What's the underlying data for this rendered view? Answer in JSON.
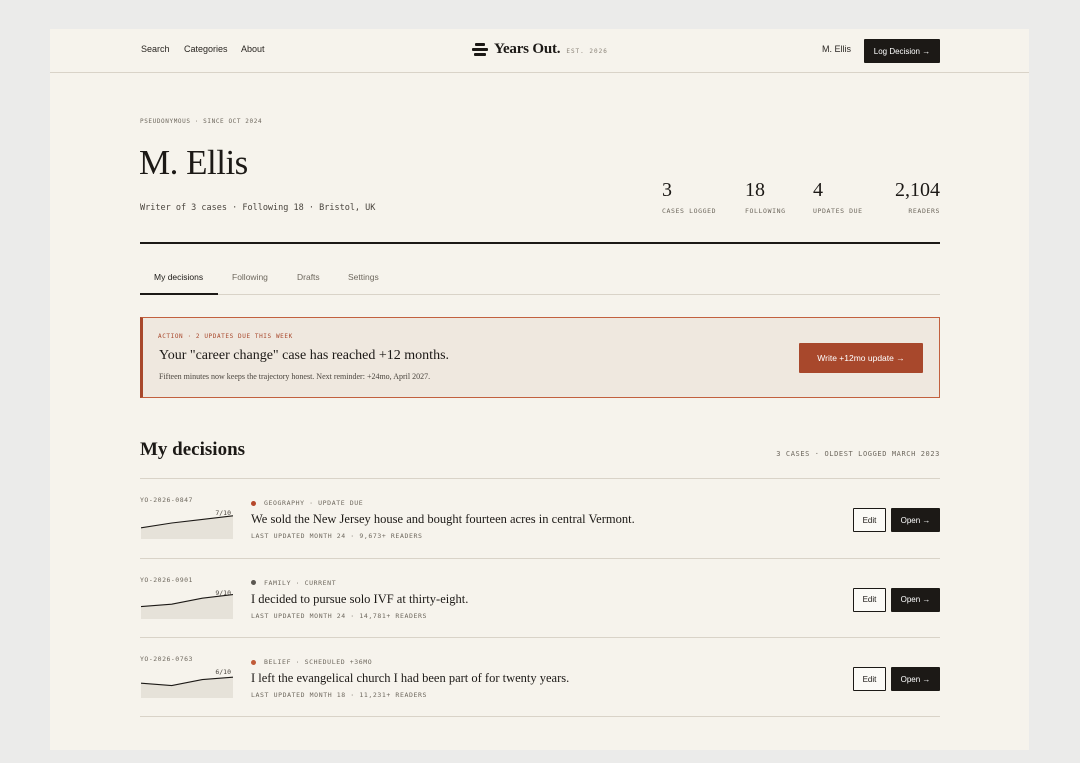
{
  "nav": {
    "links": [
      "Search",
      "Categories",
      "About"
    ],
    "logo_text": "Years Out.",
    "logo_est": "EST. 2026",
    "user_name": "M. Ellis",
    "log_button": "Log Decision →"
  },
  "profile": {
    "kicker": "PSEUDONYMOUS · SINCE OCT 2024",
    "name": "M. Ellis",
    "subline": "Writer of 3 cases · Following 18 · Bristol, UK",
    "stats": [
      {
        "value": "3",
        "label": "CASES LOGGED"
      },
      {
        "value": "18",
        "label": "FOLLOWING"
      },
      {
        "value": "4",
        "label": "UPDATES DUE"
      },
      {
        "value": "2,104",
        "label": "READERS"
      }
    ]
  },
  "tabs": [
    "My decisions",
    "Following",
    "Drafts",
    "Settings"
  ],
  "alert": {
    "kicker": "ACTION · 2 UPDATES DUE THIS WEEK",
    "title": "Your \"career change\" case has reached +12 months.",
    "sub": "Fifteen minutes now keeps the trajectory honest. Next reminder: +24mo, April 2027.",
    "button": "Write +12mo update →"
  },
  "section": {
    "title": "My decisions",
    "meta": "3 CASES · OLDEST LOGGED MARCH 2023"
  },
  "colors": {
    "accent": "#a8482c",
    "ink": "#1c1916",
    "paper": "#f6f3ec",
    "dot_due": "#b5472b",
    "dot_current": "#5b5751",
    "dot_scheduled": "#c05a38"
  },
  "decisions": [
    {
      "id": "YO-2026-0847",
      "spark_label": "7/10",
      "spark": [
        3,
        5,
        6.5,
        8
      ],
      "dot_color": "#b5472b",
      "tag": "GEOGRAPHY · UPDATE DUE",
      "title": "We sold the New Jersey house and bought fourteen acres in central Vermont.",
      "meta": "LAST UPDATED MONTH 24 · 9,673+ READERS",
      "edit": "Edit",
      "open": "Open →"
    },
    {
      "id": "YO-2026-0901",
      "spark_label": "9/10",
      "spark": [
        3.5,
        4.5,
        7,
        8.5
      ],
      "dot_color": "#5b5751",
      "tag": "FAMILY · CURRENT",
      "title": "I decided to pursue solo IVF at thirty-eight.",
      "meta": "LAST UPDATED MONTH 24 · 14,781+ READERS",
      "edit": "Edit",
      "open": "Open →"
    },
    {
      "id": "YO-2026-0763",
      "spark_label": "6/10",
      "spark": [
        4.5,
        3.5,
        6,
        7
      ],
      "dot_color": "#c05a38",
      "tag": "BELIEF · SCHEDULED +36MO",
      "title": "I left the evangelical church I had been part of for twenty years.",
      "meta": "LAST UPDATED MONTH 18 · 11,231+ READERS",
      "edit": "Edit",
      "open": "Open →"
    }
  ]
}
